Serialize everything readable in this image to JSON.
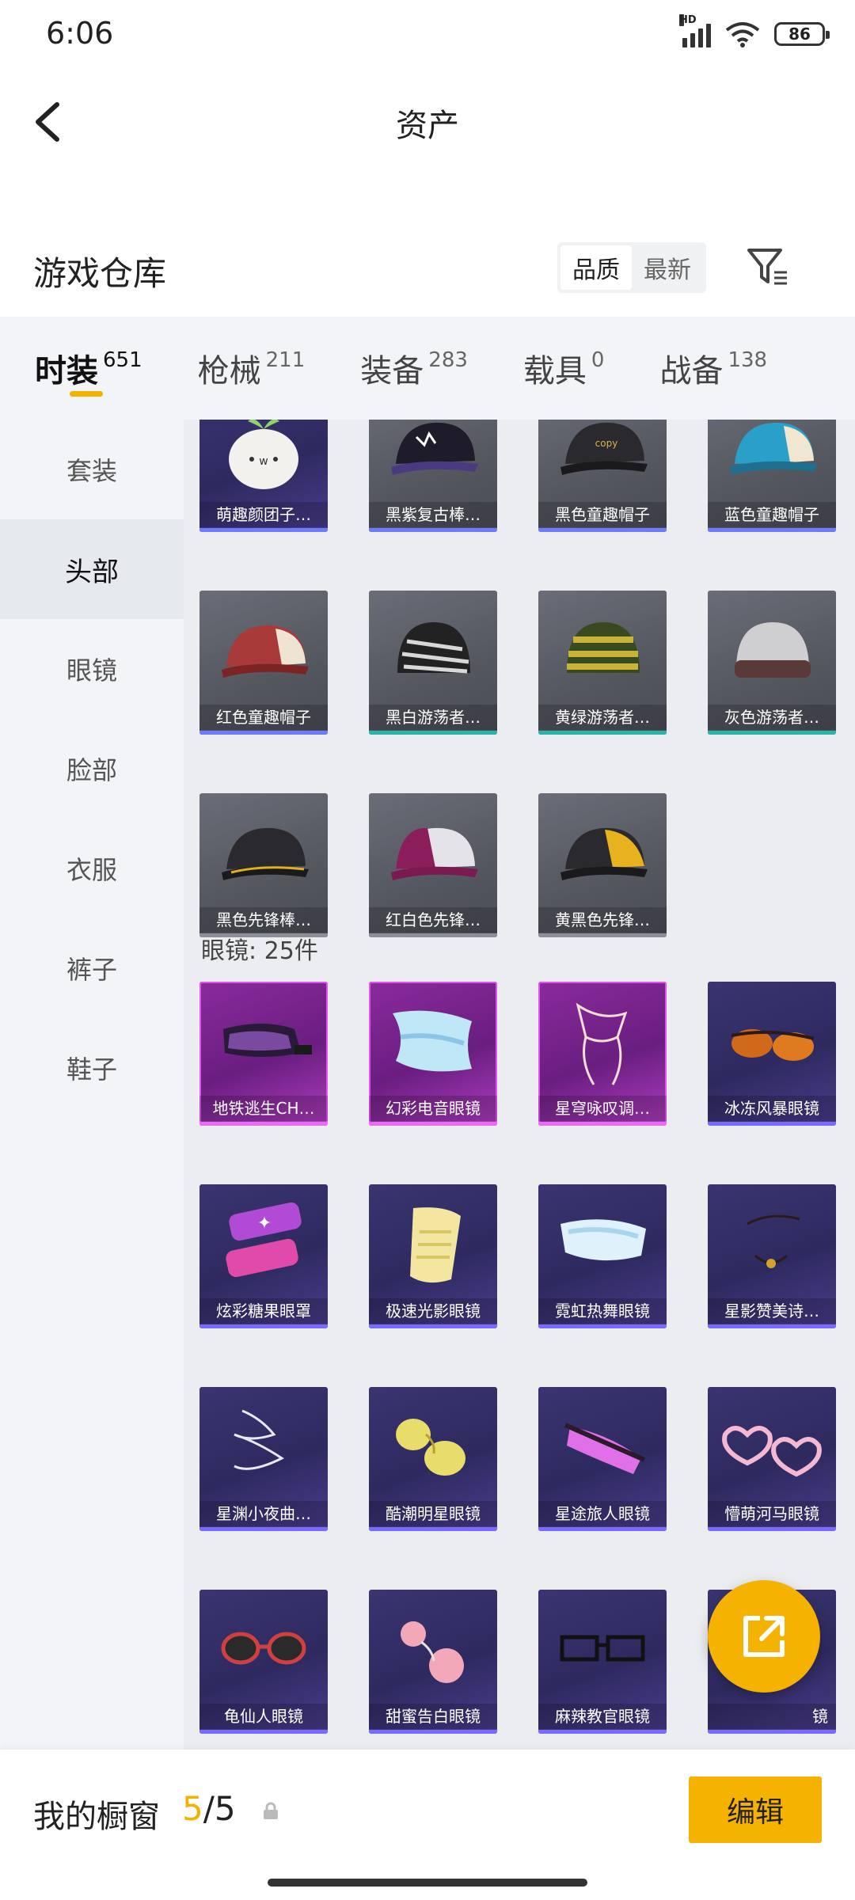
{
  "status_bar": {
    "time": "6:06",
    "battery": "86",
    "network": "HD"
  },
  "header": {
    "title": "资产"
  },
  "section": {
    "title": "游戏仓库",
    "sort": {
      "options": [
        "品质",
        "最新"
      ],
      "selected": "品质"
    }
  },
  "tabs": [
    {
      "label": "时装",
      "count": "651",
      "active": true
    },
    {
      "label": "枪械",
      "count": "211"
    },
    {
      "label": "装备",
      "count": "283"
    },
    {
      "label": "载具",
      "count": "0"
    },
    {
      "label": "战备",
      "count": "138"
    }
  ],
  "sidebar": {
    "items": [
      {
        "label": "套装"
      },
      {
        "label": "头部",
        "active": true
      },
      {
        "label": "眼镜"
      },
      {
        "label": "脸部"
      },
      {
        "label": "衣服"
      },
      {
        "label": "裤子"
      },
      {
        "label": "鞋子"
      }
    ]
  },
  "head_items": [
    {
      "name": "萌趣颜团子…",
      "rarity": "purple"
    },
    {
      "name": "黑紫复古棒…",
      "rarity": "gray-blue"
    },
    {
      "name": "黑色童趣帽子",
      "rarity": "gray-blue"
    },
    {
      "name": "蓝色童趣帽子",
      "rarity": "gray-blue"
    },
    {
      "name": "红色童趣帽子",
      "rarity": "gray-blue"
    },
    {
      "name": "黑白游荡者…",
      "rarity": "gray-teal"
    },
    {
      "name": "黄绿游荡者…",
      "rarity": "gray-teal"
    },
    {
      "name": "灰色游荡者…",
      "rarity": "gray-teal"
    },
    {
      "name": "黑色先锋棒…",
      "rarity": "gray"
    },
    {
      "name": "红白色先锋…",
      "rarity": "gray"
    },
    {
      "name": "黄黑色先锋…",
      "rarity": "gray"
    }
  ],
  "glasses_group": {
    "title": "眼镜: 25件",
    "items": [
      {
        "name": "地铁逃生CH…",
        "rarity": "pink"
      },
      {
        "name": "幻彩电音眼镜",
        "rarity": "pink"
      },
      {
        "name": "星穹咏叹调…",
        "rarity": "pink"
      },
      {
        "name": "冰冻风暴眼镜",
        "rarity": "purple"
      },
      {
        "name": "炫彩糖果眼罩",
        "rarity": "purple"
      },
      {
        "name": "极速光影眼镜",
        "rarity": "purple"
      },
      {
        "name": "霓虹热舞眼镜",
        "rarity": "purple"
      },
      {
        "name": "星影赞美诗…",
        "rarity": "purple"
      },
      {
        "name": "星渊小夜曲…",
        "rarity": "purple"
      },
      {
        "name": "酷潮明星眼镜",
        "rarity": "purple"
      },
      {
        "name": "星途旅人眼镜",
        "rarity": "purple"
      },
      {
        "name": "懵萌河马眼镜",
        "rarity": "purple"
      },
      {
        "name": "龟仙人眼镜",
        "rarity": "purple"
      },
      {
        "name": "甜蜜告白眼镜",
        "rarity": "purple"
      },
      {
        "name": "麻辣教官眼镜",
        "rarity": "purple"
      },
      {
        "name": "镜",
        "rarity": "purple"
      }
    ]
  },
  "bottom_bar": {
    "label": "我的橱窗",
    "used": "5",
    "separator": "/",
    "total": "5",
    "edit_label": "编辑"
  },
  "colors": {
    "accent": "#f5b100",
    "rare_purple": "#3a3470",
    "rare_pink": "#8a2a9c"
  }
}
